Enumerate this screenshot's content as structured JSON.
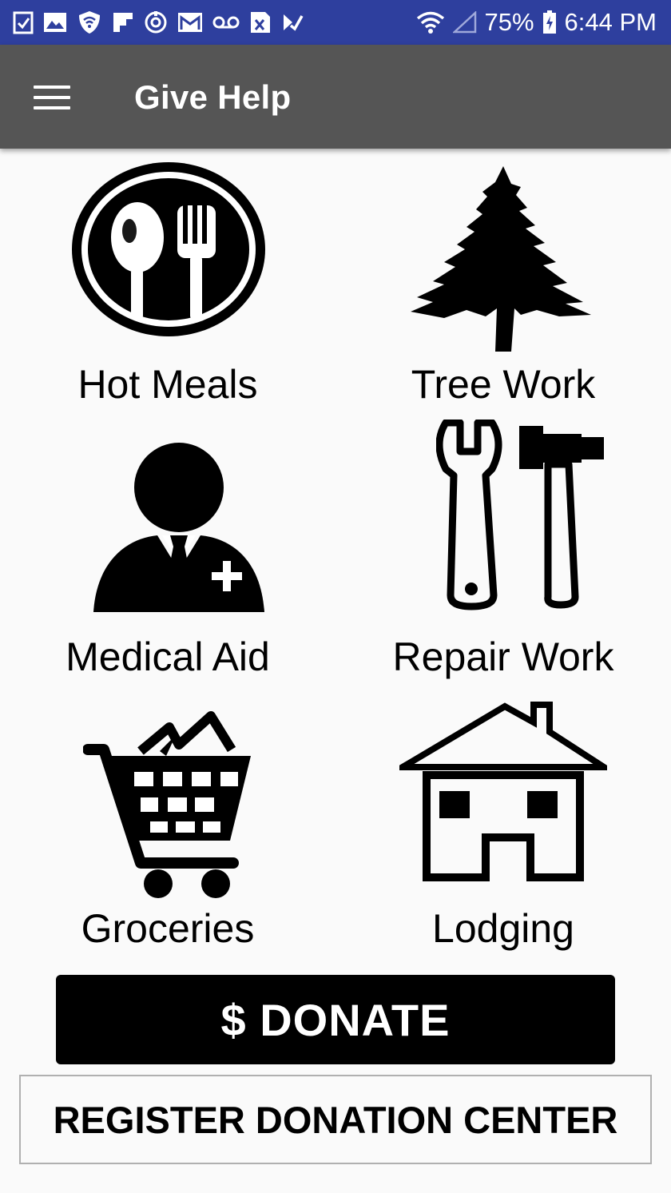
{
  "status_bar": {
    "battery": "75%",
    "time": "6:44 PM",
    "left_icons": [
      "checkbox-icon",
      "image-icon",
      "shield-wifi-icon",
      "flipboard-icon",
      "sync-icon",
      "gmail-icon",
      "voicemail-icon",
      "excel-icon",
      "check-arrow-icon"
    ],
    "right_icons": [
      "wifi-icon",
      "signal-icon",
      "battery-charging-icon"
    ]
  },
  "app_bar": {
    "title": "Give Help",
    "menu_icon": "hamburger-menu-icon"
  },
  "categories": [
    {
      "label": "Hot Meals",
      "icon": "utensils-icon"
    },
    {
      "label": "Tree Work",
      "icon": "tree-icon"
    },
    {
      "label": "Medical Aid",
      "icon": "medic-person-icon"
    },
    {
      "label": "Repair Work",
      "icon": "tools-icon"
    },
    {
      "label": "Groceries",
      "icon": "shopping-cart-icon"
    },
    {
      "label": "Lodging",
      "icon": "house-icon"
    }
  ],
  "buttons": {
    "donate": "$ DONATE",
    "register": "REGISTER DONATION CENTER"
  },
  "colors": {
    "status_bar": "#2e3f9e",
    "app_bar": "#555555",
    "background": "#fafafa",
    "donate_button": "#000000"
  }
}
